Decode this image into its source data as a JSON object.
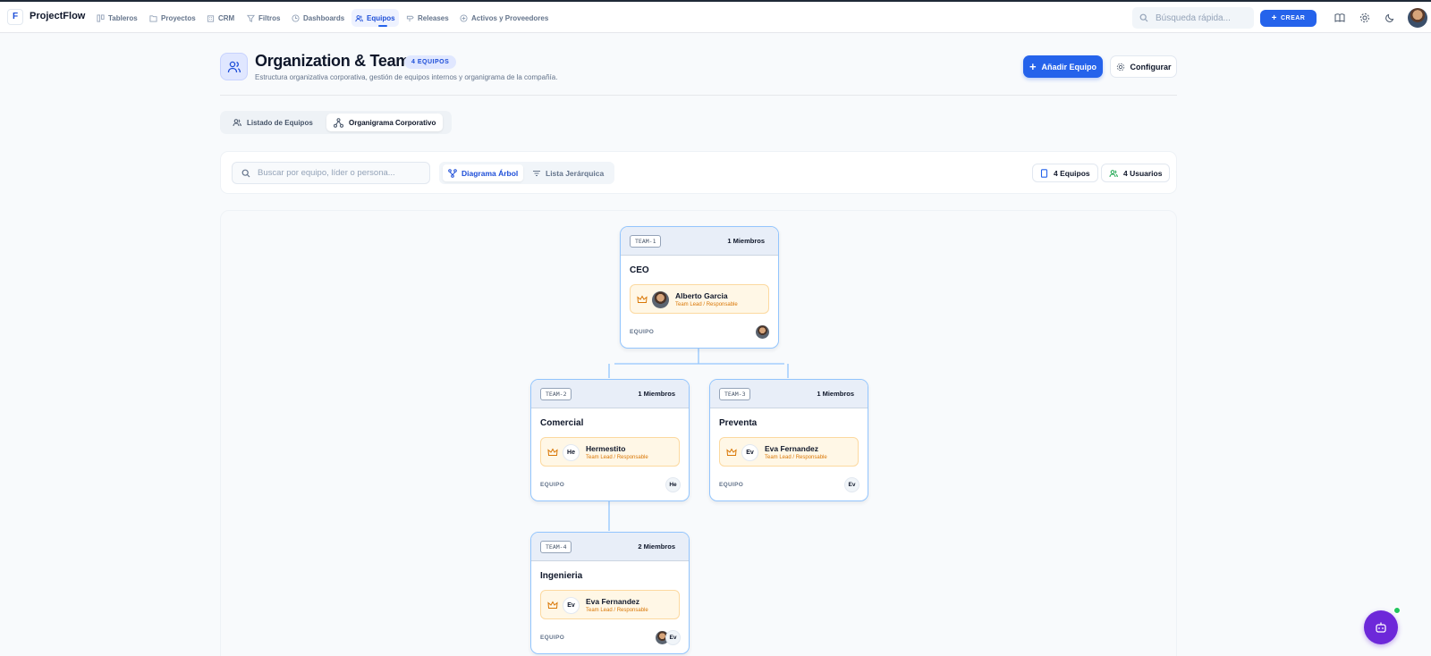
{
  "app": {
    "brand": "ProjectFlow",
    "logo_letter": "F"
  },
  "nav": [
    {
      "key": "tableros",
      "label": "Tableros",
      "icon": "board-icon"
    },
    {
      "key": "proyectos",
      "label": "Proyectos",
      "icon": "folder-icon"
    },
    {
      "key": "crm",
      "label": "CRM",
      "icon": "building-icon"
    },
    {
      "key": "filtros",
      "label": "Filtros",
      "icon": "filter-icon"
    },
    {
      "key": "dashboards",
      "label": "Dashboards",
      "icon": "clock-icon"
    },
    {
      "key": "equipos",
      "label": "Equipos",
      "icon": "users-icon",
      "active": true
    },
    {
      "key": "releases",
      "label": "Releases",
      "icon": "signpost-icon"
    },
    {
      "key": "activos",
      "label": "Activos y Proveedores",
      "icon": "box-icon"
    }
  ],
  "top": {
    "search_placeholder": "Búsqueda rápida...",
    "create_label": "CREAR"
  },
  "header": {
    "title": "Organization & Teams",
    "badge": "4 EQUIPOS",
    "subtitle": "Estructura organizativa corporativa, gestión de equipos internos y organigrama de la compañía.",
    "add_label": "Añadir Equipo",
    "config_label": "Configurar"
  },
  "tabs": [
    {
      "label": "Listado de Equipos"
    },
    {
      "label": "Organigrama Corporativo",
      "active": true
    }
  ],
  "filters": {
    "search_placeholder": "Buscar por equipo, líder o persona...",
    "view_tree": "Diagrama Árbol",
    "view_list": "Lista Jerárquica",
    "teams_count": "4 Equipos",
    "users_count": "4 Usuarios"
  },
  "org": {
    "equipo_label": "EQUIPO",
    "lead_role": "Team Lead / Responsable",
    "nodes": [
      {
        "code": "TEAM-1",
        "members": "1 Miembros",
        "name": "CEO",
        "lead": "Alberto Garcia",
        "lead_initials": "",
        "lead_photo": true,
        "member_avatars": [
          ""
        ]
      },
      {
        "code": "TEAM-2",
        "members": "1 Miembros",
        "name": "Comercial",
        "lead": "Hermestito",
        "lead_initials": "He",
        "lead_photo": false,
        "member_avatars": [
          "He"
        ]
      },
      {
        "code": "TEAM-3",
        "members": "1 Miembros",
        "name": "Preventa",
        "lead": "Eva Fernandez",
        "lead_initials": "Ev",
        "lead_photo": false,
        "member_avatars": [
          "Ev"
        ]
      },
      {
        "code": "TEAM-4",
        "members": "2 Miembros",
        "name": "Ingenieria",
        "lead": "Eva Fernandez",
        "lead_initials": "Ev",
        "lead_photo": false,
        "member_avatars": [
          "",
          "Ev"
        ]
      }
    ]
  }
}
